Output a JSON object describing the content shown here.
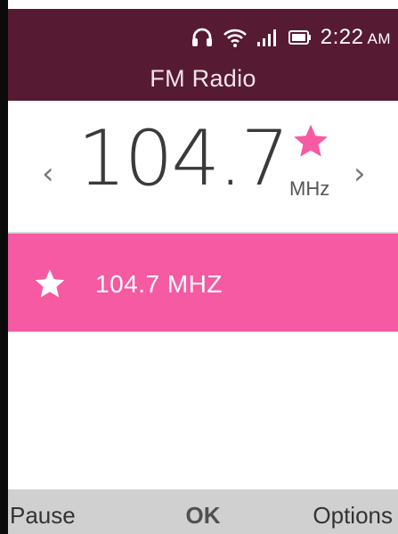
{
  "status_bar": {
    "time": "2:22",
    "ampm": "AM",
    "icons": [
      "headphones-icon",
      "wifi-icon",
      "signal-icon",
      "battery-icon"
    ]
  },
  "header": {
    "title": "FM Radio"
  },
  "tuner": {
    "frequency": "104.7",
    "unit": "MHz",
    "prev_arrow": "‹",
    "next_arrow": "›",
    "favorite": true
  },
  "favorites": [
    {
      "label": "104.7 MHZ",
      "selected": true
    }
  ],
  "softkeys": {
    "left": "Pause",
    "center": "OK",
    "right": "Options"
  },
  "colors": {
    "header_bg": "#561a32",
    "accent_pink": "#f55aa2",
    "softkey_bg": "#d0d0d0"
  }
}
